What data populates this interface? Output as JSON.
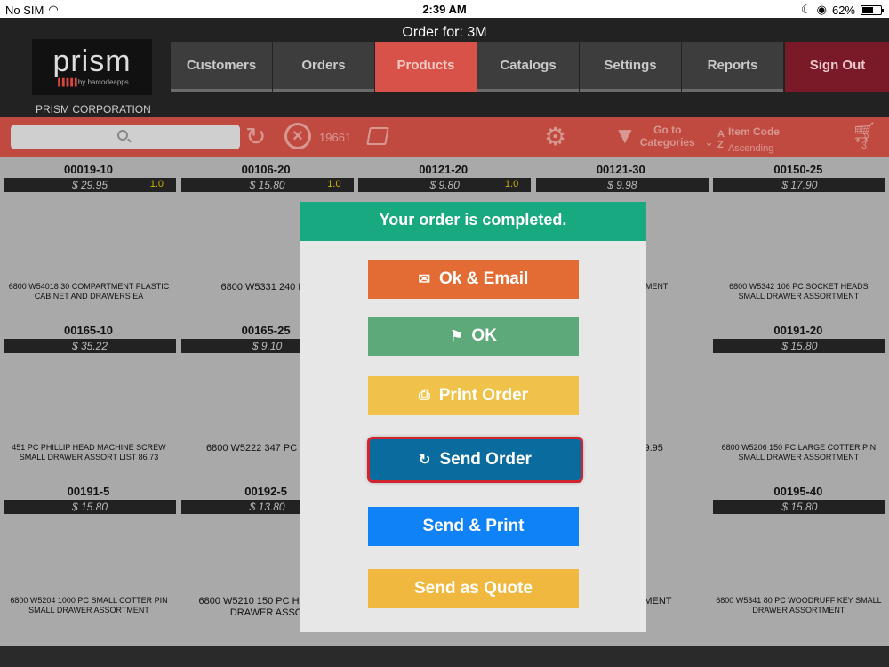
{
  "status_bar": {
    "carrier": "No SIM",
    "time": "2:39 AM",
    "battery": "62%",
    "battery_level": 0.62
  },
  "header": {
    "order_for": "Order for: 3M",
    "logo_word": "prism",
    "logo_sub": "by barcodeapps",
    "company": "PRISM CORPORATION",
    "tabs": [
      "Customers",
      "Orders",
      "Products",
      "Catalogs",
      "Settings",
      "Reports"
    ],
    "signout": "Sign Out"
  },
  "toolbar": {
    "search_placeholder": "",
    "item_count": "19661",
    "goto": "Go to Categories",
    "goto_l1": "Go to",
    "goto_l2": "Categories",
    "sort_title": "Item Code",
    "sort_dir": "Ascending",
    "cart_count": "3",
    "icons": [
      "search-icon",
      "refresh-icon",
      "clear-icon",
      "catalog-book-icon",
      "gear-icon",
      "funnel-icon",
      "sort-az-icon",
      "cart-icon"
    ]
  },
  "products": [
    {
      "code": "00019-10",
      "price": "$ 29.95",
      "qty": "1.0",
      "desc": "6800 W54018 30 COMPARTMENT PLASTIC CABINET AND DRAWERS EA",
      "big": false
    },
    {
      "code": "00106-20",
      "price": "$ 15.80",
      "qty": "1.0",
      "desc": "6800 W5331 240 PC",
      "big": true
    },
    {
      "code": "00121-20",
      "price": "$ 9.80",
      "qty": "1.0",
      "desc": "",
      "big": false
    },
    {
      "code": "00121-30",
      "price": "$ 9.98",
      "qty": "",
      "desc": "EXT MACH SSORTMENT",
      "big": false
    },
    {
      "code": "00150-25",
      "price": "$ 17.90",
      "qty": "",
      "desc": "6800 W5342 106 PC SOCKET HEADS SMALL DRAWER ASSORTMENT",
      "big": false
    },
    {
      "code": "00165-10",
      "price": "$ 35.22",
      "qty": "",
      "desc": "451 PC PHILLIP HEAD MACHINE SCREW SMALL DRAWER ASSORT LIST 86.73",
      "big": false
    },
    {
      "code": "00165-25",
      "price": "$ 9.10",
      "qty": "",
      "desc": "6800 W5222 347 PC NUTS",
      "big": true
    },
    {
      "code": "",
      "price": "",
      "qty": "",
      "desc": "",
      "big": false
    },
    {
      "code": "",
      "price": "",
      "qty": "",
      "desc": "N SMALL ST 39.95",
      "big": true
    },
    {
      "code": "00191-20",
      "price": "$ 15.80",
      "qty": "",
      "desc": "6800 W5206 150 PC LARGE COTTER PIN SMALL DRAWER ASSORTMENT",
      "big": false
    },
    {
      "code": "00191-5",
      "price": "$ 15.80",
      "qty": "",
      "desc": "6800 W5204 1000 PC SMALL COTTER PIN SMALL DRAWER ASSORTMENT",
      "big": false
    },
    {
      "code": "00192-5",
      "price": "$ 13.80",
      "qty": "",
      "desc": "6800 W5210 150 PC H SMALL DRAWER ASSO",
      "big": true
    },
    {
      "code": "",
      "price": "",
      "qty": "",
      "desc": "",
      "big": false
    },
    {
      "code": "",
      "price": "",
      "qty": "",
      "desc": "PRING PIN ORTMENT",
      "big": true
    },
    {
      "code": "00195-40",
      "price": "$ 15.80",
      "qty": "",
      "desc": "6800 W5341 80 PC WOODRUFF KEY SMALL DRAWER ASSORTMENT",
      "big": false
    }
  ],
  "modal": {
    "title": "Your order is completed.",
    "ok_email": "Ok & Email",
    "ok": "OK",
    "print_order": "Print Order",
    "send_order": "Send Order",
    "send_print": "Send & Print",
    "send_quote": "Send as Quote",
    "icons": [
      "envelope-icon",
      "flags-icon",
      "printer-icon",
      "send-refresh-icon"
    ]
  }
}
